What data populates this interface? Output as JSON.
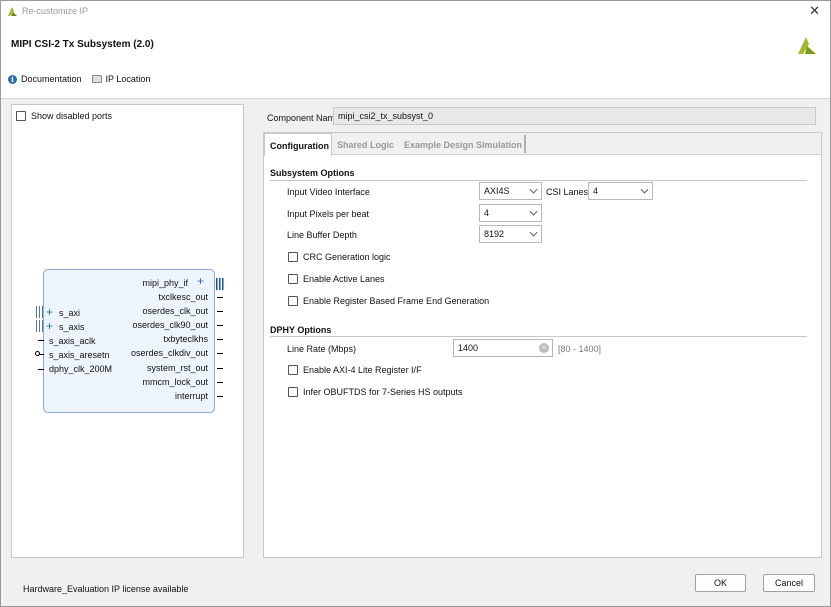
{
  "window": {
    "title": "Re-customize IP",
    "close_glyph": "✕"
  },
  "header": {
    "ip_title": "MIPI CSI-2 Tx Subsystem (2.0)",
    "documentation_label": "Documentation",
    "ip_location_label": "IP Location",
    "info_glyph": "i"
  },
  "left_panel": {
    "show_disabled_label": "Show disabled ports",
    "block": {
      "outputs": [
        "mipi_phy_if",
        "txclkesc_out",
        "oserdes_clk_out",
        "oserdes_clk90_out",
        "txbyteclkhs",
        "oserdes_clkdiv_out",
        "system_rst_out",
        "mmcm_lock_out",
        "interrupt"
      ],
      "inputs": [
        "s_axi",
        "s_axis",
        "s_axis_aclk",
        "s_axis_aresetn",
        "dphy_clk_200M"
      ],
      "plus_glyph": "+"
    }
  },
  "right_panel": {
    "component_name_label": "Component Name",
    "component_name_value": "mipi_csi2_tx_subsyst_0",
    "tabs": [
      {
        "label": "Configuration",
        "active": true
      },
      {
        "label": "Shared Logic",
        "active": false
      },
      {
        "label": "Example Design Simulation",
        "active": false
      }
    ],
    "subsystem_options": {
      "title": "Subsystem Options",
      "input_video_interface_label": "Input Video Interface",
      "input_video_interface_value": "AXI4S",
      "csi_lanes_label": "CSI Lanes",
      "csi_lanes_value": "4",
      "pixels_per_beat_label": "Input Pixels per beat",
      "pixels_per_beat_value": "4",
      "line_buffer_depth_label": "Line Buffer Depth",
      "line_buffer_depth_value": "8192",
      "crc_label": "CRC Generation logic",
      "crc_checked": false,
      "active_lanes_label": "Enable Active Lanes",
      "active_lanes_checked": false,
      "frame_end_label": "Enable Register Based Frame End Generation",
      "frame_end_checked": false
    },
    "dphy_options": {
      "title": "DPHY Options",
      "line_rate_label": "Line Rate (Mbps)",
      "line_rate_value": "1400",
      "line_rate_range": "[80 - 1400]",
      "clear_glyph": "×",
      "axi_lite_label": "Enable AXI-4 Lite Register I/F",
      "axi_lite_checked": false,
      "obuftds_label": "Infer OBUFTDS for 7-Series HS outputs",
      "obuftds_checked": false
    }
  },
  "footer": {
    "license_text": "Hardware_Evaluation IP license available",
    "ok_label": "OK",
    "cancel_label": "Cancel"
  },
  "colors": {
    "accent_green": "#a6b82a",
    "block_fill": "#eef4fb",
    "block_border": "#8fa9c6",
    "info_blue": "#2a6bb5"
  },
  "icons": [
    "app-logo-icon",
    "close-icon",
    "brand-logo-icon",
    "info-icon",
    "folder-icon",
    "chevron-down-icon",
    "clear-icon",
    "plus-icon",
    "bus-icon"
  ]
}
